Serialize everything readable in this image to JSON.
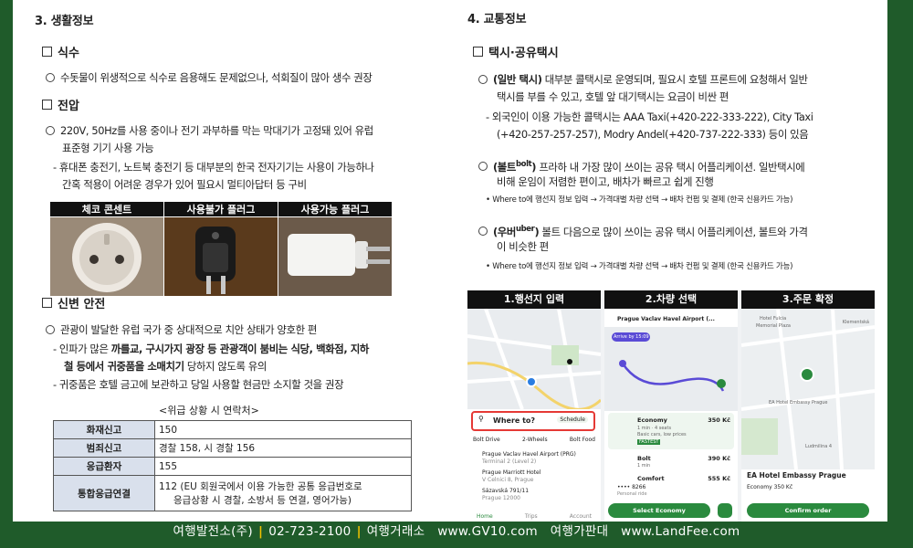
{
  "left": {
    "section_title": "3. 생활정보",
    "water": {
      "title": "식수",
      "text": "수돗물이 위생적으로 식수로 음용해도 문제없으나, 석회질이 많아 생수 권장"
    },
    "power": {
      "title": "전압",
      "line1": "220V, 50Hz를 사용 중이나 전기 과부하를 막는 막대기가 고정돼 있어 유럽",
      "line2": "표준형 기기 사용 가능",
      "line3": "- 휴대폰 충전기, 노트북 충전기 등 대부분의 한국 전자기기는 사용이 가능하나",
      "line4": "간혹 적용이 어려운 경우가 있어 필요시 멀티아답터 등 구비",
      "photo_headers": [
        "체코 콘센트",
        "사용불가 플러그",
        "사용가능 플러그"
      ]
    },
    "safety": {
      "title": "신변 안전",
      "line1": "관광이 발달한 유럽 국가 중 상대적으로 치안 상태가 양호한 편",
      "line2a": "- 인파가 많은 ",
      "line2b": "까를교, 구시가지 광장 등 관광객이 붐비는 식당, 백화점, 지하",
      "line3a": "철 등에서 ",
      "line3b": "귀중품을 소매치기",
      "line3c": " 당하지 않도록 유의",
      "line4": "- 귀중품은 호텔 금고에 보관하고 당일 사용할 현금만 소지할 것을 권장",
      "emergency_caption": "<위급 상황 시 연락처>",
      "emergency": [
        {
          "k": "화재신고",
          "v1": "150",
          "v2": ""
        },
        {
          "k": "범죄신고",
          "v1": "경찰 158, 시 경찰 156",
          "v2": ""
        },
        {
          "k": "응급환자",
          "v1": "155",
          "v2": ""
        },
        {
          "k": "통합응급연결",
          "v1": "112 (EU 회원국에서 이용 가능한 공통 응급번호로",
          "v2": "응급상황 시 경찰, 소방서 등 연결, 영어가능)"
        }
      ]
    }
  },
  "right": {
    "section_title": "4. 교통정보",
    "taxi_title": "택시·공유택시",
    "regular": {
      "label": "(일반 택시)",
      "l1": " 대부분 콜택시로 운영되며, 필요시 호텔 프론트에 요청해서 일반",
      "l2": "택시를 부를 수 있고, 호텔 앞 대기택시는 요금이 비싼 편",
      "l3": "- 외국인이 이용 가능한 콜택시는 AAA Taxi(+420-222-333-222), City Taxi",
      "l4": "(+420-257-257-257), Modry Andel(+420-737-222-333) 등이 있음"
    },
    "bolt": {
      "label": "(볼트",
      "sup": "bolt",
      "label_end": ")",
      "l1": " 프라하 내 가장 많이 쓰이는 공유 택시 어플리케이션. 일반택시에",
      "l2": "비해 운임이 저렴한 편이고, 배차가 빠르고 쉽게 진행",
      "l3": "• Where to에 행선지 정보 입력 → 가격대별 차량 선택 → 배차 컨펌 및 결제 (한국 신용카드 가능)"
    },
    "uber": {
      "label": "(우버",
      "sup": "uber",
      "label_end": ")",
      "l1": " 볼트 다음으로 많이 쓰이는 공유 택시 어플리케이션, 볼트와 가격",
      "l2": "이 비슷한 편",
      "l3": "• Where to에 행선지 정보 입력 → 가격대별 차량 선택 → 배차 컨펌 및 결제 (한국 신용카드 가능)"
    },
    "phones": {
      "titles": [
        "1.행선지 입력",
        "2.차량 선택",
        "3.주문 확정"
      ],
      "p1": {
        "search": "Where to?",
        "schedule": "Schedule",
        "tabs": [
          "Bolt Drive",
          "2-Wheels",
          "Bolt Food"
        ],
        "places": [
          {
            "name": "Prague Vaclav Havel Airport (PRG)",
            "sub": "Terminal 2 (Level 2)"
          },
          {
            "name": "Prague Marriott Hotel",
            "sub": "V Celnici 8, Prague"
          },
          {
            "name": "Sázavská 791/11",
            "sub": "Prague 12000"
          }
        ],
        "nav": [
          "Home",
          "Trips",
          "Account"
        ]
      },
      "p2": {
        "route": "Prague Vaclav Havel Airport (...",
        "arrive": "Arrive by 15:09",
        "options": [
          {
            "name": "Economy",
            "price": "350 Kč",
            "sub": "1 min · 4 seats",
            "note": "Basic cars, low prices",
            "badge": "FASTEST"
          },
          {
            "name": "Bolt",
            "price": "390 Kč",
            "sub": "1 min"
          },
          {
            "name": "Comfort",
            "price": "555 Kč",
            "sub": ""
          }
        ],
        "card": "•••• 8266",
        "card_sub": "Personal ride",
        "cta": "Select Economy"
      },
      "p3": {
        "hotel": "EA Hotel Embassy Prague",
        "ride": "Economy",
        "price": "350 Kč",
        "cta": "Confirm order",
        "labels": [
          "Hotel Fulcia",
          "Memorial Plaza",
          "Klementská",
          "EA Hotel Embassy Prague",
          "Ludmilina 4"
        ]
      }
    }
  },
  "footer": {
    "company": "여행발전소(주)",
    "phone": "02-723-2100",
    "brand1": "여행거래소",
    "site1": "www.GV10.com",
    "brand2": "여행가판대",
    "site2": "www.LandFee.com"
  }
}
